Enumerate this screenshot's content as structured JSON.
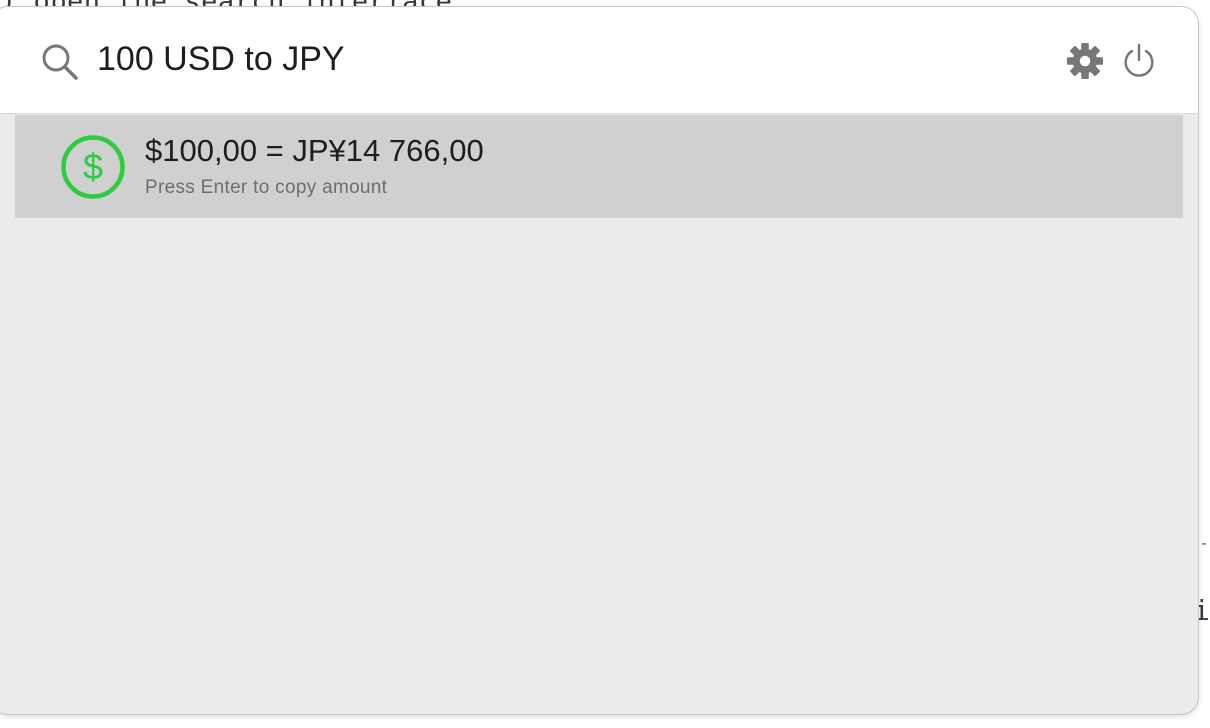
{
  "background": {
    "terminal_text": ") open the search interface",
    "right_glyph_a": "-",
    "right_glyph_b": "i"
  },
  "search": {
    "query": "100 USD to JPY",
    "placeholder": ""
  },
  "toolbar": {
    "settings_icon": "gear-icon",
    "power_icon": "power-icon"
  },
  "results": [
    {
      "icon": "dollar-circle-icon",
      "title": "$100,00 = JP¥14 766,00",
      "subtitle": "Press Enter to copy amount"
    }
  ],
  "colors": {
    "accent_green": "#2ecc40",
    "selected_row": "#d0d0d0",
    "window_bg": "#ebebeb",
    "icon_gray": "#777777"
  }
}
